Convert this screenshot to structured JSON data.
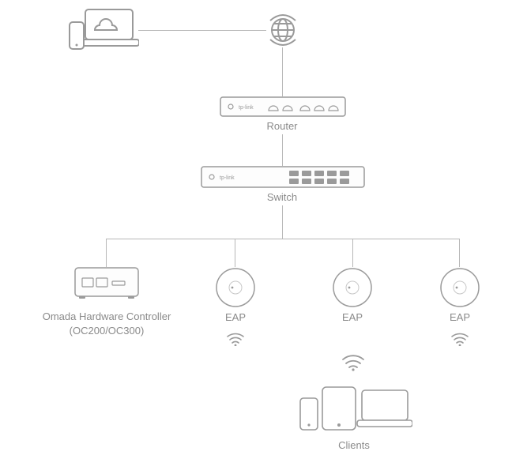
{
  "diagram": {
    "type": "network-topology",
    "vendor_brand": "tp-link",
    "nodes": {
      "cloud_clients": {
        "type": "laptop-phone-cloud"
      },
      "internet": {
        "type": "globe"
      },
      "router": {
        "type": "router",
        "label": "Router",
        "brand": "tp-link"
      },
      "switch": {
        "type": "switch",
        "label": "Switch",
        "brand": "tp-link"
      },
      "controller": {
        "type": "hardware-controller",
        "label": "Omada Hardware Controller\n(OC200/OC300)"
      },
      "eap1": {
        "type": "eap",
        "label": "EAP"
      },
      "eap2": {
        "type": "eap",
        "label": "EAP"
      },
      "eap3": {
        "type": "eap",
        "label": "EAP"
      },
      "clients": {
        "type": "client-devices",
        "label": "Clients"
      }
    },
    "edges": [
      [
        "cloud_clients",
        "internet"
      ],
      [
        "internet",
        "router"
      ],
      [
        "router",
        "switch"
      ],
      [
        "switch",
        "controller"
      ],
      [
        "switch",
        "eap1"
      ],
      [
        "switch",
        "eap2"
      ],
      [
        "switch",
        "eap3"
      ],
      [
        "eap1",
        "wifi"
      ],
      [
        "eap2",
        "wifi"
      ],
      [
        "eap3",
        "wifi"
      ],
      [
        "eap2",
        "clients"
      ]
    ]
  },
  "labels": {
    "router": "Router",
    "switch": "Switch",
    "controller": "Omada Hardware Controller\n(OC200/OC300)",
    "eap": "EAP",
    "clients": "Clients",
    "brand": "tp-link"
  }
}
